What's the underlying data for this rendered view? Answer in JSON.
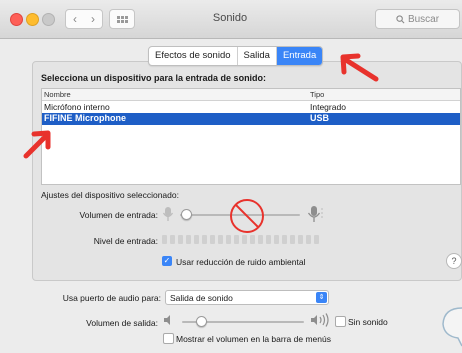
{
  "window": {
    "title": "Sonido",
    "search_placeholder": "Buscar"
  },
  "tabs": [
    {
      "label": "Efectos de sonido",
      "selected": false
    },
    {
      "label": "Salida",
      "selected": false
    },
    {
      "label": "Entrada",
      "selected": true
    }
  ],
  "input": {
    "heading": "Selecciona un dispositivo para la entrada de sonido:",
    "columns": [
      "Nombre",
      "Tipo"
    ],
    "devices": [
      {
        "name": "Micrófono interno",
        "type": "Integrado",
        "selected": false
      },
      {
        "name": "FIFINE Microphone",
        "type": "USB",
        "selected": true
      }
    ],
    "settings_label": "Ajustes del dispositivo seleccionado:",
    "volume_label": "Volumen de entrada:",
    "level_label": "Nivel de entrada:",
    "noise_label": "Usar reducción de ruido ambiental",
    "noise_checked": true
  },
  "output": {
    "audio_port_label": "Usa puerto de audio para:",
    "audio_port_value": "Salida de sonido",
    "volume_label": "Volumen de salida:",
    "mute_label": "Sin sonido",
    "mute_checked": false,
    "menu_bar_label": "Mostrar el volumen en la barra de menús",
    "menu_bar_checked": false
  },
  "colors": {
    "accent": "#3a85f7",
    "selection": "#1e5ec6",
    "annotation": "#e8322c"
  }
}
